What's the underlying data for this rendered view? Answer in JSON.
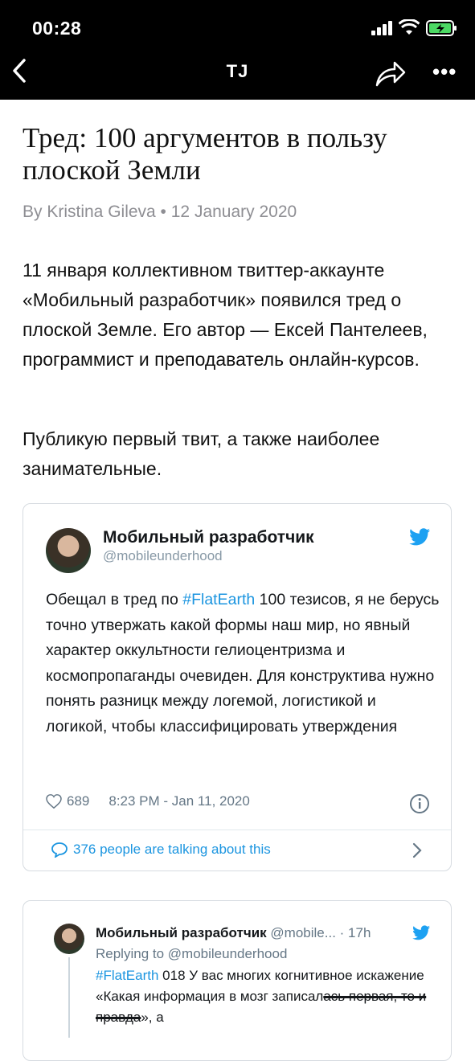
{
  "status_bar": {
    "time": "00:28"
  },
  "nav": {
    "title": "TJ"
  },
  "article": {
    "headline": "Тред: 100 аргументов в пользу плоской Земли",
    "byline": "By Kristina Gileva • 12 January 2020",
    "paragraph1": "11 января коллективном твиттер-аккаунте «Мобильный разработчик» появился тред о плоской Земле. Его автор — Ексей Пантелеев, программист и преподаватель онлайн-курсов.",
    "paragraph2": "Публикую первый твит, а также наиболее занимательные."
  },
  "tweet1": {
    "name": "Мобильный разработчик",
    "handle": "@mobileunderhood",
    "text_before": "Обещал в тред по ",
    "hashtag": "#FlatEarth",
    "text_after": " 100 тезисов, я не берусь точно утвержать какой формы наш мир, но явный характер оккультности гелиоцентризма и космопропаганды очевиден. Для конструктива нужно понять разницк между логемой, логистикой и логикой, чтобы классифицировать утверждения",
    "likes": "689",
    "timestamp": "8:23 PM - Jan 11, 2020",
    "talking": "376 people are talking about this"
  },
  "tweet2": {
    "name": "Мобильный разработчик",
    "handle": "@mobile...",
    "age": "· 17h",
    "replying": "Replying to @mobileunderhood",
    "hashtag": "#FlatEarth",
    "text1": " 018 У вас многих когнитивное искажение «Какая информация в мозг записал",
    "text_struck": "ась первая, то и правда",
    "text2": "», а"
  },
  "colors": {
    "link": "#1b95e0",
    "twitter_blue": "#1da1f2",
    "muted": "#8e8e93"
  }
}
